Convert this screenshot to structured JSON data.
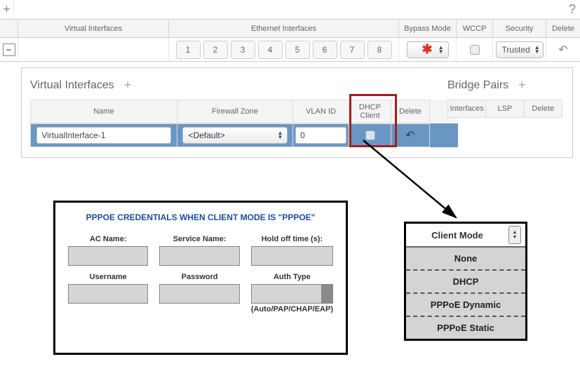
{
  "ui": {
    "plus": "+",
    "help": "?",
    "collapse": "−",
    "revert": "↶"
  },
  "header": {
    "virtual_interfaces": "Virtual Interfaces",
    "ethernet_interfaces": "Ethernet Interfaces",
    "bypass_mode": "Bypass Mode",
    "wccp": "WCCP",
    "security": "Security",
    "delete": "Delete"
  },
  "ports": [
    "1",
    "2",
    "3",
    "4",
    "5",
    "6",
    "7",
    "8"
  ],
  "bypass_marker": "✱",
  "security_value": "Trusted",
  "detail": {
    "virtual_interfaces_title": "Virtual Interfaces",
    "bridge_pairs_title": "Bridge Pairs",
    "vi_columns": {
      "name": "Name",
      "firewall_zone": "Firewall Zone",
      "vlan_id": "VLAN ID",
      "dhcp_client": "DHCP Client",
      "delete": "Delete"
    },
    "vi_row": {
      "name": "VirtualInterface-1",
      "firewall_zone": "<Default>",
      "vlan_id": "0"
    },
    "bridge_columns": {
      "interfaces": "Interfaces",
      "lsp": "LSP",
      "delete": "Delete"
    }
  },
  "pppoe": {
    "title": "PPPOE CREDENTIALS WHEN CLIENT MODE IS \"PPPOE\"",
    "fields": {
      "ac_name": "AC Name:",
      "service_name": "Service Name:",
      "hold_off": "Hold off time (s):",
      "username": "Username",
      "password": "Password",
      "auth_type": "Auth Type"
    },
    "auth_hint": "(Auto/PAP/CHAP/EAP)"
  },
  "client_mode": {
    "label": "Client Mode",
    "options": [
      "None",
      "DHCP",
      "PPPoE Dynamic",
      "PPPoE Static"
    ]
  }
}
